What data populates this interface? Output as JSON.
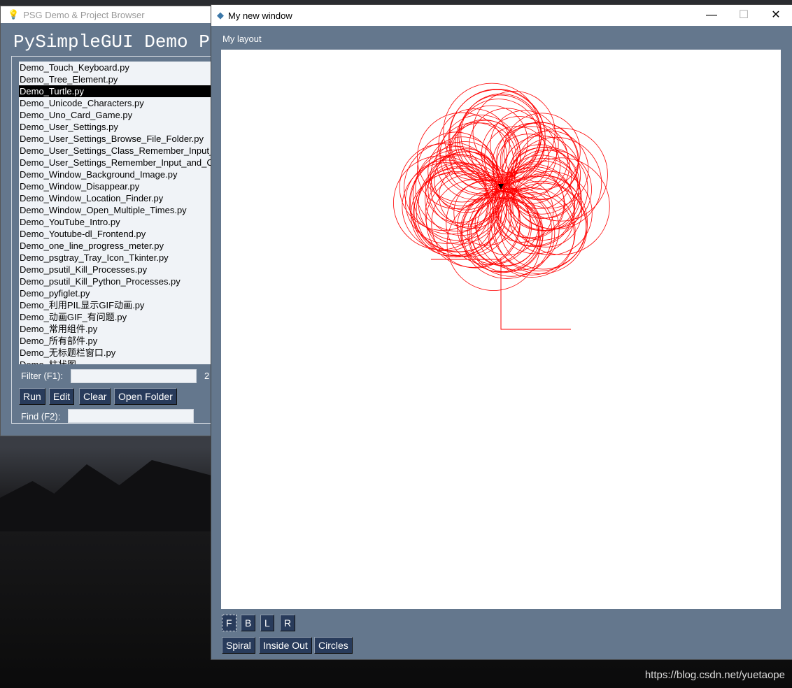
{
  "back_window": {
    "title": "PSG Demo & Project Browser",
    "heading": "PySimpleGUI Demo Pro",
    "files": [
      "Demo_Touch_Keyboard.py",
      "Demo_Tree_Element.py",
      "Demo_Turtle.py",
      "Demo_Unicode_Characters.py",
      "Demo_Uno_Card_Game.py",
      "Demo_User_Settings.py",
      "Demo_User_Settings_Browse_File_Folder.py",
      "Demo_User_Settings_Class_Remember_Input_",
      "Demo_User_Settings_Remember_Input_and_C",
      "Demo_Window_Background_Image.py",
      "Demo_Window_Disappear.py",
      "Demo_Window_Location_Finder.py",
      "Demo_Window_Open_Multiple_Times.py",
      "Demo_YouTube_Intro.py",
      "Demo_Youtube-dl_Frontend.py",
      "Demo_one_line_progress_meter.py",
      "Demo_psgtray_Tray_Icon_Tkinter.py",
      "Demo_psutil_Kill_Processes.py",
      "Demo_psutil_Kill_Python_Processes.py",
      "Demo_pyfiglet.py",
      "Demo_利用PIL显示GIF动画.py",
      "Demo_动画GIF_有问题.py",
      "Demo_常用组件.py",
      "Demo_所有部件.py",
      "Demo_无标题栏窗口.py",
      "Demo_柱状图"
    ],
    "selected_index": 2,
    "filter_label": "Filter (F1):",
    "filter_value": "",
    "count": "2",
    "find_label": "Find (F2):",
    "find_value": "",
    "buttons": [
      "Run",
      "Edit",
      "Clear",
      "Open Folder"
    ]
  },
  "front_window": {
    "title": "My new window",
    "minimize": "—",
    "maximize": "☐",
    "close": "✕",
    "layout_label": "My layout",
    "direction_buttons": [
      "F",
      "B",
      "L",
      "R"
    ],
    "pattern_buttons": [
      "Spiral",
      "Inside Out",
      "Circles"
    ],
    "pen_color": "#ff0000"
  },
  "watermark": "https://blog.csdn.net/yuetaope"
}
